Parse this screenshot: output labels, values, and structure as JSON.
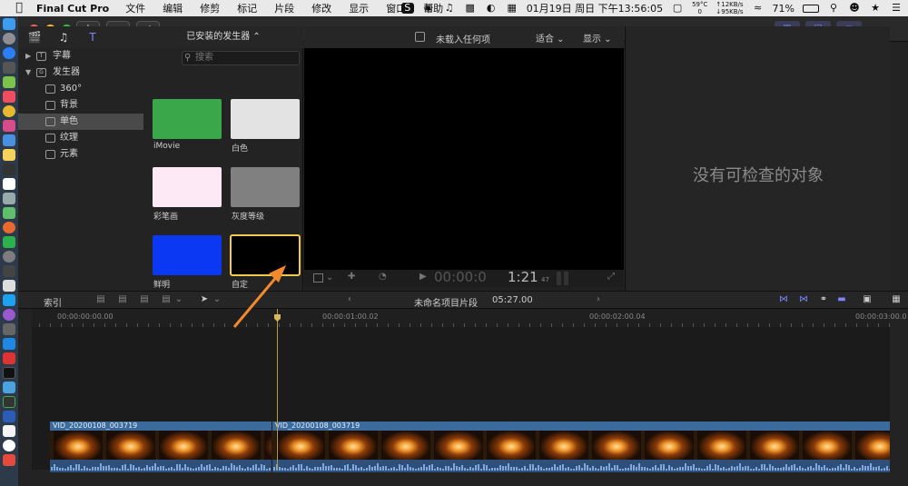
{
  "menubar": {
    "app_name": "Final Cut Pro",
    "menus": [
      "文件",
      "编辑",
      "修剪",
      "标记",
      "片段",
      "修改",
      "显示",
      "窗口",
      "帮助"
    ],
    "temp": "59°C",
    "cpu_value": "0",
    "net_up": "↑12KB/s",
    "net_down": "↓95KB/s",
    "datetime": "01月19日 周日 下午13:56:05",
    "battery": "71%"
  },
  "sidebar": {
    "items": [
      {
        "label": "字幕",
        "level": 0,
        "expanded": false
      },
      {
        "label": "发生器",
        "level": 0,
        "expanded": true
      },
      {
        "label": "360°",
        "level": 1
      },
      {
        "label": "背景",
        "level": 1
      },
      {
        "label": "单色",
        "level": 1,
        "selected": true
      },
      {
        "label": "纹理",
        "level": 1
      },
      {
        "label": "元素",
        "level": 1
      }
    ]
  },
  "generators": {
    "header": "已安装的发生器 ⌃",
    "search_placeholder": "搜索",
    "items": [
      {
        "label": "iMovie",
        "color": "#3aa84a"
      },
      {
        "label": "白色",
        "color": "#e3e3e3"
      },
      {
        "label": "彩笔画",
        "color": "#fde8f6"
      },
      {
        "label": "灰度等级",
        "color": "#808080"
      },
      {
        "label": "鲜明",
        "color": "#0b38f2"
      },
      {
        "label": "自定",
        "color": "#000000",
        "selected": true
      }
    ]
  },
  "viewer": {
    "title": "未载入任何项",
    "fit_label": "适合 ⌄",
    "display_label": "显示 ⌄",
    "timecode_dim": "00:00:0",
    "timecode_main": "1:21",
    "timecode_frames": "47"
  },
  "inspector": {
    "empty_text": "没有可检查的对象"
  },
  "timeline": {
    "index_label": "索引",
    "project_name": "未命名项目片段",
    "duration": "05:27.00",
    "ruler": [
      "00:00:00:00.00",
      "00:00:01:00.02",
      "00:00:02:00.04",
      "00:00:03:00.0"
    ],
    "clips": [
      "VID_20200108_003719",
      "VID_20200108_003719"
    ]
  },
  "colors": {
    "accent": "#7b84ff",
    "selection": "#f2c94c",
    "arrow": "#f08a2c",
    "clip_blue": "#3b6b9c"
  }
}
